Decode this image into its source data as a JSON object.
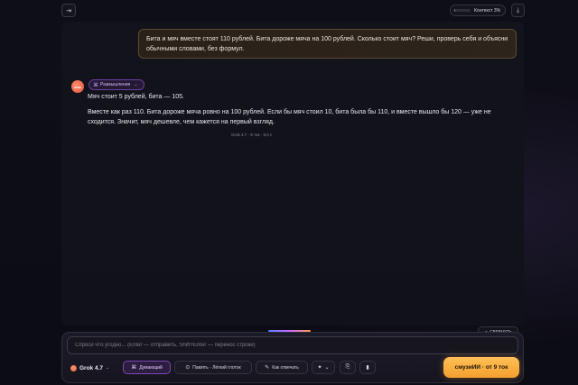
{
  "header": {
    "sidebar_toggle_icon": "sidebar-toggle-icon",
    "context_label": "Контекст 3%",
    "context_percent": 3,
    "download_icon": "download-icon"
  },
  "conversation": {
    "user_message": "Бита и мяч вместе стоят 110 рублей. Бита дороже мяча на 100 рублей. Сколько стоит мяч? Реши, проверь себя и объясни обычными словами, без формул.",
    "assistant": {
      "avatar_label": "smz",
      "thinking_chip_label": "Размышления",
      "answer_short": "Мяч стоит 5 рублей, бита — 105.",
      "answer_explanation": "Вместе как раз 110. Бита дороже мяча ровно на 100 рублей. Если бы мяч стоил 10, бита была бы 110, и вместе вышло бы 120 — уже не сходится. Значит, мяч дешевле, чем кажется на первый взгляд.",
      "meta": "Grok 4.7 · 9 ток · 9,0 с"
    }
  },
  "collapse_button_label": "СВЕРНУТЬ",
  "composer": {
    "placeholder": "Спроси что угодно... (Enter — отправить, Shift+Enter — перенос строки)",
    "model_label": "Grok 4.7",
    "thinking_toggle_label": "Думающий",
    "memory_label": "Память · Лёгкий глоток",
    "style_label": "Как отвечать",
    "cta_label": "смузиИИ · от 9 ток"
  },
  "colors": {
    "accent_orange": "#f3a02e",
    "accent_purple": "#7a48b8",
    "user_bubble_border": "#5c4a34"
  }
}
